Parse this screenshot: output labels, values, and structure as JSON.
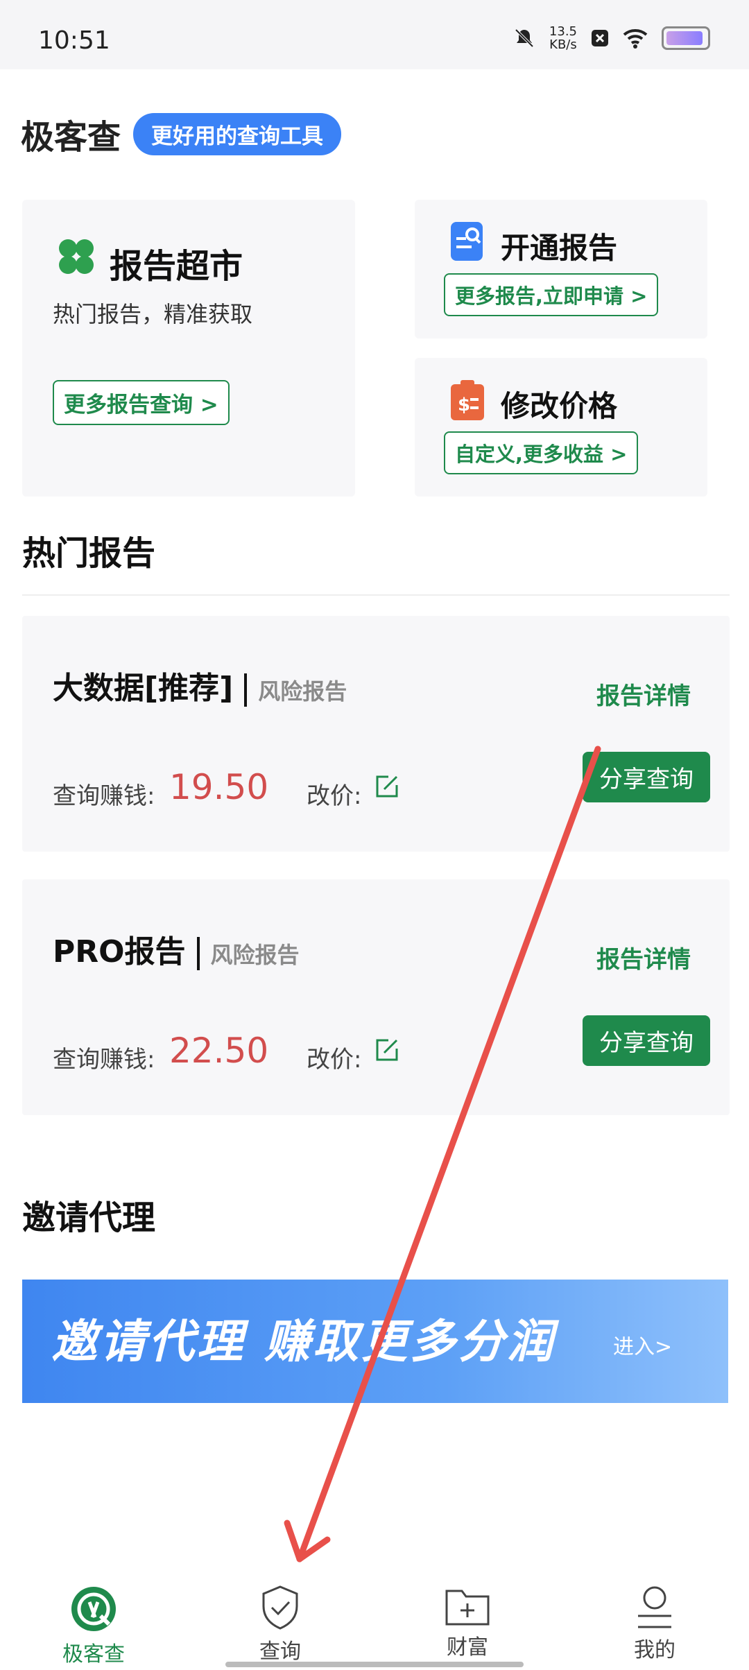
{
  "status_bar": {
    "time": "10:51",
    "speed_value": "13.5",
    "speed_unit": "KB/s"
  },
  "header": {
    "app_name": "极客查",
    "slogan": "更好用的查询工具"
  },
  "feature_cards": {
    "market": {
      "title": "报告超市",
      "subtitle": "热门报告，精准获取",
      "button": "更多报告查询 >"
    },
    "open": {
      "title": "开通报告",
      "button": "更多报告,立即申请 >"
    },
    "price": {
      "title": "修改价格",
      "button": "自定义,更多收益 >"
    }
  },
  "hot_reports": {
    "section_title": "热门报告",
    "items": [
      {
        "name": "大数据[推荐]",
        "tag": "风险报告",
        "detail": "报告详情",
        "earn_label": "查询赚钱:",
        "earn_value": "19.50",
        "edit_label": "改价:",
        "share": "分享查询"
      },
      {
        "name": "PRO报告",
        "tag": "风险报告",
        "detail": "报告详情",
        "earn_label": "查询赚钱:",
        "earn_value": "22.50",
        "edit_label": "改价:",
        "share": "分享查询"
      }
    ]
  },
  "invite": {
    "section_title": "邀请代理",
    "banner_text": "邀请代理 赚取更多分润",
    "banner_enter": "进入>"
  },
  "tabbar": {
    "items": [
      "极客查",
      "查询",
      "财富",
      "我的"
    ],
    "active_index": 0
  },
  "colors": {
    "green": "#1f8a4c",
    "blue": "#3b82f6",
    "red": "#d24d4d",
    "annotation": "#e8504a"
  }
}
